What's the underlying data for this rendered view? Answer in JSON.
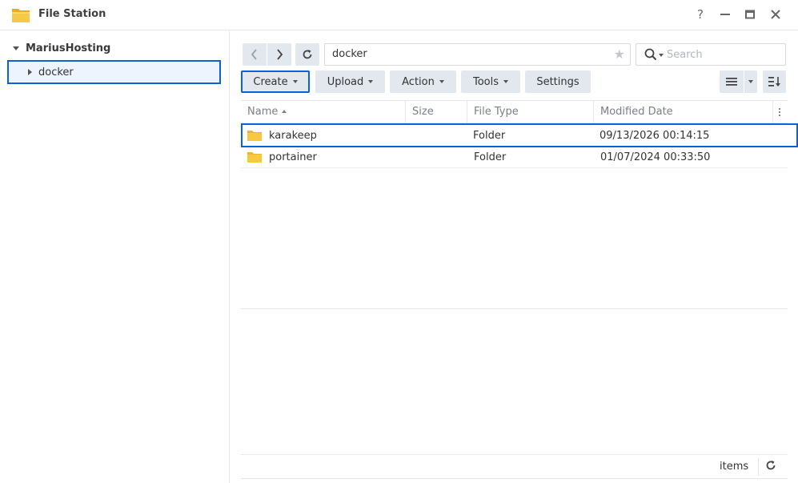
{
  "window": {
    "title": "File Station",
    "controls": [
      "help",
      "minimize",
      "maximize",
      "close"
    ],
    "help_label": "?"
  },
  "sidebar": {
    "root_label": "MariusHosting",
    "items": [
      {
        "label": "docker",
        "selected": true
      }
    ]
  },
  "navigation": {
    "path": "docker",
    "search_placeholder": "Search"
  },
  "toolbar": {
    "create_label": "Create",
    "upload_label": "Upload",
    "action_label": "Action",
    "tools_label": "Tools",
    "settings_label": "Settings"
  },
  "table": {
    "columns": [
      "Name",
      "Size",
      "File Type",
      "Modified Date"
    ],
    "rows": [
      {
        "name": "karakeep",
        "size": "",
        "type": "Folder",
        "modified": "09/13/2026 00:14:15",
        "selected": true
      },
      {
        "name": "portainer",
        "size": "",
        "type": "Folder",
        "modified": "01/07/2024 00:33:50",
        "selected": false
      }
    ]
  },
  "footer": {
    "items_label": "items"
  },
  "colors": {
    "accent": "#0b62d6",
    "button_bg": "#e3e8ee",
    "folder": "#f5c542"
  }
}
